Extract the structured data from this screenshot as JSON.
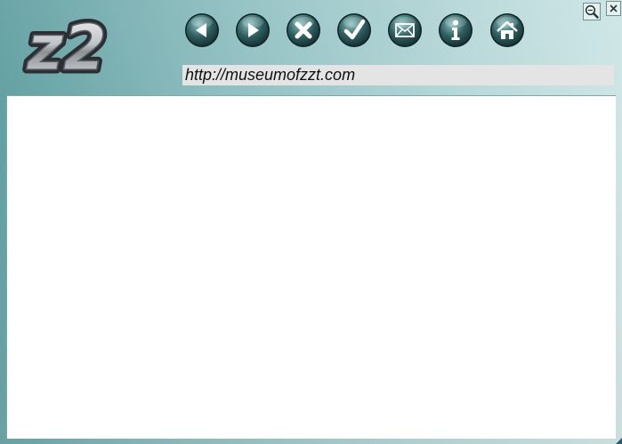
{
  "app": {
    "logo_text": "z2"
  },
  "toolbar": {
    "buttons": [
      {
        "id": "back",
        "icon": "arrow-left-icon"
      },
      {
        "id": "forward",
        "icon": "arrow-right-icon"
      },
      {
        "id": "stop",
        "icon": "x-icon"
      },
      {
        "id": "ok",
        "icon": "checkmark-icon"
      },
      {
        "id": "mail",
        "icon": "envelope-icon"
      },
      {
        "id": "info",
        "icon": "info-icon"
      },
      {
        "id": "home",
        "icon": "house-icon"
      }
    ]
  },
  "address": {
    "url": "http://museumofzzt.com"
  },
  "window_controls": {
    "zoom_icon": "magnifier-minus-icon",
    "close_icon": "close-icon"
  },
  "colors": {
    "background_start": "#5f9ea0",
    "background_end": "#d6eaea",
    "button_dark": "#1f4446",
    "button_light": "#7fb3b5",
    "url_bar_bg": "#e4e4e4",
    "content_bg": "#ffffff"
  }
}
